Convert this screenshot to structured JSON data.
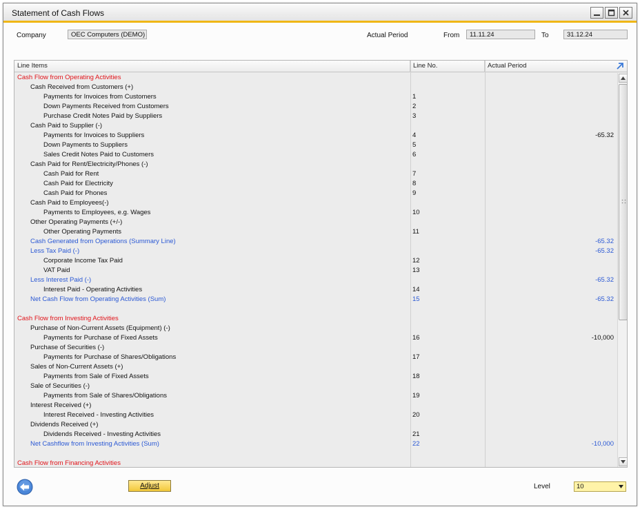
{
  "window": {
    "title": "Statement of Cash Flows"
  },
  "header": {
    "company_label": "Company",
    "company_value": "OEC Computers (DEMO)",
    "period_label": "Actual Period",
    "from_label": "From",
    "from_value": "11.11.24",
    "to_label": "To",
    "to_value": "31.12.24"
  },
  "grid": {
    "columns": [
      "Line Items",
      "Line No.",
      "Actual Period"
    ],
    "rows": [
      {
        "text": "Cash Flow from Operating Activities",
        "line": "",
        "value": "",
        "level": 0,
        "style": "red"
      },
      {
        "text": "Cash Received from Customers (+)",
        "line": "",
        "value": "",
        "level": 1,
        "style": ""
      },
      {
        "text": "Payments for Invoices from Customers",
        "line": "1",
        "value": "",
        "level": 2,
        "style": ""
      },
      {
        "text": "Down Payments Received from Customers",
        "line": "2",
        "value": "",
        "level": 2,
        "style": ""
      },
      {
        "text": "Purchase Credit Notes Paid by Suppliers",
        "line": "3",
        "value": "",
        "level": 2,
        "style": ""
      },
      {
        "text": "Cash Paid to Supplier  (-)",
        "line": "",
        "value": "",
        "level": 1,
        "style": ""
      },
      {
        "text": "Payments for Invoices to Suppliers",
        "line": "4",
        "value": "-65.32",
        "level": 2,
        "style": ""
      },
      {
        "text": "Down Payments to Suppliers",
        "line": "5",
        "value": "",
        "level": 2,
        "style": ""
      },
      {
        "text": "Sales Credit Notes Paid to Customers",
        "line": "6",
        "value": "",
        "level": 2,
        "style": ""
      },
      {
        "text": "Cash Paid for Rent/Electricity/Phones (-)",
        "line": "",
        "value": "",
        "level": 1,
        "style": ""
      },
      {
        "text": "Cash Paid for Rent",
        "line": "7",
        "value": "",
        "level": 2,
        "style": ""
      },
      {
        "text": "Cash Paid for Electricity",
        "line": "8",
        "value": "",
        "level": 2,
        "style": ""
      },
      {
        "text": "Cash Paid for Phones",
        "line": "9",
        "value": "",
        "level": 2,
        "style": ""
      },
      {
        "text": "Cash Paid to Employees(-)",
        "line": "",
        "value": "",
        "level": 1,
        "style": ""
      },
      {
        "text": "Payments to Employees, e.g. Wages",
        "line": "10",
        "value": "",
        "level": 2,
        "style": ""
      },
      {
        "text": "Other Operating Payments (+/-)",
        "line": "",
        "value": "",
        "level": 1,
        "style": ""
      },
      {
        "text": "Other Operating Payments",
        "line": "11",
        "value": "",
        "level": 2,
        "style": ""
      },
      {
        "text": "Cash Generated from Operations (Summary Line)",
        "line": "",
        "value": "-65.32",
        "level": 1,
        "style": "blue"
      },
      {
        "text": "Less Tax Paid (-)",
        "line": "",
        "value": "-65.32",
        "level": 1,
        "style": "blue"
      },
      {
        "text": "Corporate Income Tax Paid",
        "line": "12",
        "value": "",
        "level": 2,
        "style": ""
      },
      {
        "text": "VAT Paid",
        "line": "13",
        "value": "",
        "level": 2,
        "style": ""
      },
      {
        "text": "Less Interest Paid (-)",
        "line": "",
        "value": "-65.32",
        "level": 1,
        "style": "blue"
      },
      {
        "text": "Interest Paid - Operating Activities",
        "line": "14",
        "value": "",
        "level": 2,
        "style": ""
      },
      {
        "text": "Net Cash Flow from Operating Activities (Sum)",
        "line": "15",
        "value": "-65.32",
        "level": 1,
        "style": "blue"
      },
      {
        "text": "",
        "line": "",
        "value": "",
        "level": 0,
        "style": ""
      },
      {
        "text": "Cash Flow from Investing Activities",
        "line": "",
        "value": "",
        "level": 0,
        "style": "red"
      },
      {
        "text": "Purchase of Non-Current Assets (Equipment) (-)",
        "line": "",
        "value": "",
        "level": 1,
        "style": ""
      },
      {
        "text": "Payments for Purchase of Fixed Assets",
        "line": "16",
        "value": "-10,000",
        "level": 2,
        "style": ""
      },
      {
        "text": "Purchase of Securities (-)",
        "line": "",
        "value": "",
        "level": 1,
        "style": ""
      },
      {
        "text": "Payments for Purchase of Shares/Obligations",
        "line": "17",
        "value": "",
        "level": 2,
        "style": ""
      },
      {
        "text": "Sales of Non-Current Assets (+)",
        "line": "",
        "value": "",
        "level": 1,
        "style": ""
      },
      {
        "text": "Payments from Sale of Fixed Assets",
        "line": "18",
        "value": "",
        "level": 2,
        "style": ""
      },
      {
        "text": "Sale of Securities (-)",
        "line": "",
        "value": "",
        "level": 1,
        "style": ""
      },
      {
        "text": "Payments from Sale of Shares/Obligations",
        "line": "19",
        "value": "",
        "level": 2,
        "style": ""
      },
      {
        "text": "Interest Received (+)",
        "line": "",
        "value": "",
        "level": 1,
        "style": ""
      },
      {
        "text": "Interest Received  - Investing Activities",
        "line": "20",
        "value": "",
        "level": 2,
        "style": ""
      },
      {
        "text": "Dividends Received (+)",
        "line": "",
        "value": "",
        "level": 1,
        "style": ""
      },
      {
        "text": "Dividends Received - Investing Activities",
        "line": "21",
        "value": "",
        "level": 2,
        "style": ""
      },
      {
        "text": "Net Cashflow from Investing Activities (Sum)",
        "line": "22",
        "value": "-10,000",
        "level": 1,
        "style": "blue"
      },
      {
        "text": "",
        "line": "",
        "value": "",
        "level": 0,
        "style": ""
      },
      {
        "text": "Cash Flow from Financing Activities",
        "line": "",
        "value": "",
        "level": 0,
        "style": "red"
      }
    ]
  },
  "footer": {
    "adjust_label": "Adjust",
    "level_label": "Level",
    "level_value": "10"
  },
  "icons": {
    "back": "back-arrow-icon",
    "expand": "expand-arrow-icon",
    "minimize": "minimize-icon",
    "maximize": "maximize-icon",
    "close": "close-icon"
  },
  "colors": {
    "accent": "#f0b716",
    "red_text": "#e1141a",
    "blue_text": "#2a58d4",
    "button_yellow": "#f2c83a"
  }
}
